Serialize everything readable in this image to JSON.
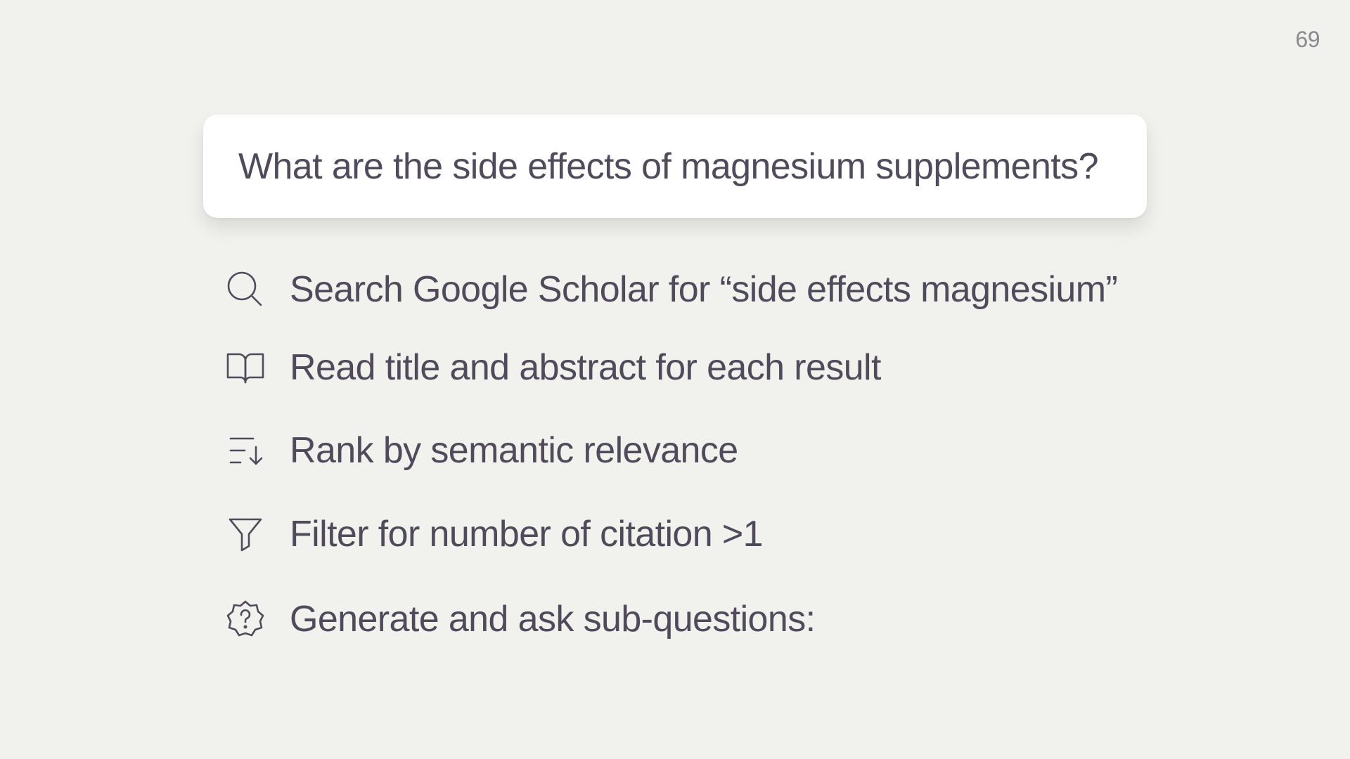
{
  "page": {
    "number": "69"
  },
  "query": {
    "text": "What are the side effects of magnesium supplements?"
  },
  "steps": [
    {
      "icon": "search-icon",
      "label": "Search Google Scholar for “side effects magnesium”"
    },
    {
      "icon": "open-book-icon",
      "label": "Read title and abstract for each result"
    },
    {
      "icon": "sort-descending-icon",
      "label": "Rank by semantic relevance"
    },
    {
      "icon": "filter-icon",
      "label": "Filter for number of citation >1"
    },
    {
      "icon": "question-badge-icon",
      "label": "Generate and ask sub-questions:"
    }
  ],
  "colors": {
    "background": "#f1f1ed",
    "text": "#4f4b5a",
    "card": "#ffffff",
    "page_number": "#8b8a8f"
  }
}
